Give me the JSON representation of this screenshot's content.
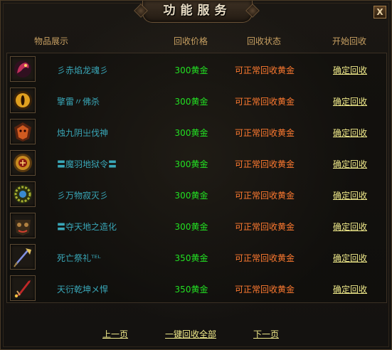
{
  "window": {
    "title": "功能服务",
    "close_label": "X"
  },
  "headers": {
    "item": "物品展示",
    "price": "回收价格",
    "status": "回收状态",
    "action": "开始回收"
  },
  "items": [
    {
      "name": "彡赤焰龙魂彡",
      "price": "300黄金",
      "status": "可正常回收黄金",
      "action": "确定回收",
      "icon": "dragon-soul-icon",
      "color": "#c0305a"
    },
    {
      "name": "擎雷〃佛杀",
      "price": "300黄金",
      "status": "可正常回收黄金",
      "action": "确定回收",
      "icon": "golden-eye-icon",
      "color": "#e0a020"
    },
    {
      "name": "烛九阴㞢伐神",
      "price": "300黄金",
      "status": "可正常回收黄金",
      "action": "确定回收",
      "icon": "demon-shield-icon",
      "color": "#d05a20"
    },
    {
      "name": "〓魔羽地狱令〓",
      "price": "300黄金",
      "status": "可正常回收黄金",
      "action": "确定回收",
      "icon": "hell-token-icon",
      "color": "#c88a20"
    },
    {
      "name": "彡万物寂灭彡",
      "price": "300黄金",
      "status": "可正常回收黄金",
      "action": "确定回收",
      "icon": "jade-emblem-icon",
      "color": "#a8b030"
    },
    {
      "name": "〓夺天地之造化",
      "price": "300黄金",
      "status": "可正常回收黄金",
      "action": "确定回收",
      "icon": "beast-mask-icon",
      "color": "#b08040"
    },
    {
      "name": "死亡祭礼ᵀᴱᴸ",
      "price": "350黄金",
      "status": "可正常回收黄金",
      "action": "确定回收",
      "icon": "staff-icon",
      "color": "#8090e0"
    },
    {
      "name": "天衍乾坤メ悍",
      "price": "350黄金",
      "status": "可正常回收黄金",
      "action": "确定回收",
      "icon": "crimson-blade-icon",
      "color": "#c02828"
    }
  ],
  "footer": {
    "prev": "上一页",
    "recycle_all": "一键回收全部",
    "next": "下一页"
  }
}
